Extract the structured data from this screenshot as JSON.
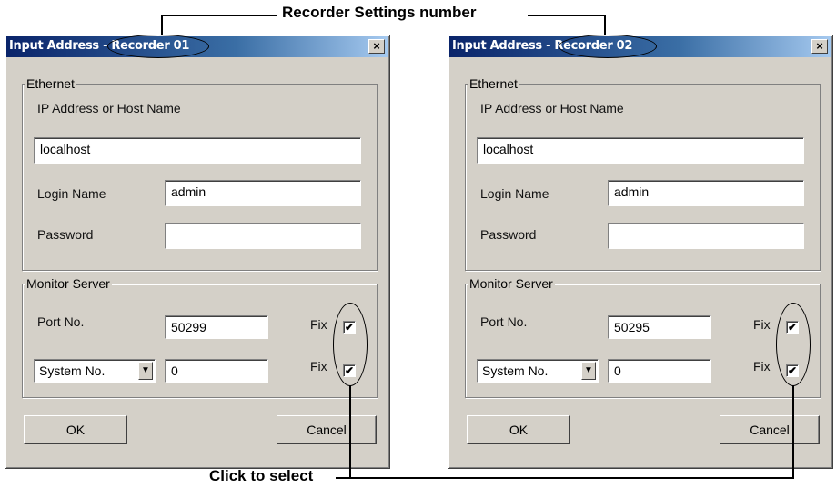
{
  "callouts": {
    "top": "Recorder Settings number",
    "bottom": "Click to select"
  },
  "dialogs": [
    {
      "title": "Input Address - Recorder 01",
      "ethernet_label": "Ethernet",
      "ip_label": "IP Address or Host Name",
      "ip_value": "localhost",
      "login_label": "Login Name",
      "login_value": "admin",
      "password_label": "Password",
      "password_value": "",
      "monitor_label": "Monitor Server",
      "port_label": "Port No.",
      "port_value": "50299",
      "fix_label": "Fix",
      "system_select": "System No.",
      "system_value": "0",
      "ok_label": "OK",
      "cancel_label": "Cancel",
      "close_glyph": "×",
      "check_glyph": "✔"
    },
    {
      "title": "Input Address - Recorder 02",
      "ethernet_label": "Ethernet",
      "ip_label": "IP Address or Host Name",
      "ip_value": "localhost",
      "login_label": "Login Name",
      "login_value": "admin",
      "password_label": "Password",
      "password_value": "",
      "monitor_label": "Monitor Server",
      "port_label": "Port No.",
      "port_value": "50295",
      "fix_label": "Fix",
      "system_select": "System No.",
      "system_value": "0",
      "ok_label": "OK",
      "cancel_label": "Cancel",
      "close_glyph": "×",
      "check_glyph": "✔"
    }
  ]
}
